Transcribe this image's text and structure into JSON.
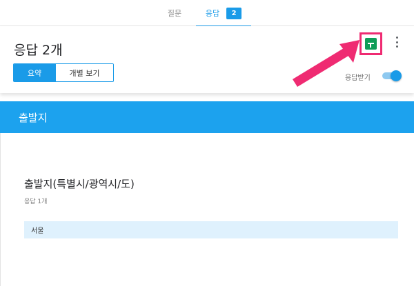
{
  "tabs": {
    "questions_label": "질문",
    "responses_label": "응답",
    "responses_count": "2"
  },
  "summary": {
    "title": "응답 2개",
    "view_summary_label": "요약",
    "view_individual_label": "개별 보기",
    "accepting_label": "응답받기",
    "accepting_on": true,
    "sheets_icon": "google-sheets-icon",
    "more_icon": "more-vert-icon"
  },
  "section": {
    "title": "출발지"
  },
  "question": {
    "title": "출발지(특별시/광역시/도)",
    "response_count": "응답 1개",
    "answers": [
      "서울"
    ]
  },
  "colors": {
    "accent": "#1a9be8",
    "section_header": "#1ca2ee",
    "answer_bg": "#dff1fd",
    "annotation_arrow": "#ef2b72",
    "sheets_green": "#0f9d58"
  }
}
